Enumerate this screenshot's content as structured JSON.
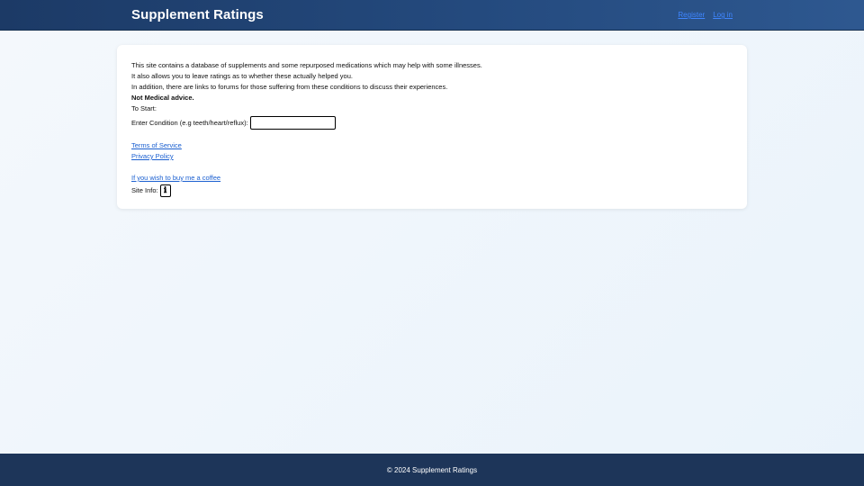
{
  "header": {
    "title": "Supplement Ratings",
    "nav": {
      "register": "Register",
      "login": "Log in"
    }
  },
  "main": {
    "intro_line1": "This site contains a database of supplements and some repurposed medications which may help with some illnesses.",
    "intro_line2": "It also allows you to leave ratings as to whether these actually helped you.",
    "intro_line3": "In addition, there are links to forums for those suffering from these conditions to discuss their experiences.",
    "disclaimer": "Not Medical advice.",
    "to_start": "To Start:",
    "condition_label": "Enter Condition (e.g teeth/heart/reflux):",
    "condition_value": "",
    "terms_link": "Terms of Service",
    "privacy_link": "Privacy Policy",
    "coffee_link": "If you wish to buy me a coffee",
    "site_info_label": "Site Info:",
    "site_info_icon": "info-icon"
  },
  "footer": {
    "copyright": "© 2024 Supplement Ratings"
  },
  "colors": {
    "header_bg": "#1c3a66",
    "footer_bg": "#1d3559",
    "link": "#1a5fd0",
    "nav_link": "#3f86ff"
  }
}
